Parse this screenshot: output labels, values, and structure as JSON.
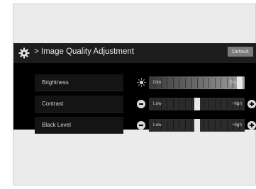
{
  "header": {
    "title": "> Image Quality Adjustment",
    "icon": "gear-icon",
    "default_label": "Default"
  },
  "rows": [
    {
      "label": "Brightness",
      "left_label": "Dim",
      "right_label": "Bright",
      "level": 0.98,
      "left_icon": "sun-icon"
    },
    {
      "label": "Contrast",
      "left_label": "Low",
      "right_label": "High",
      "level": 0.5,
      "left_icon": "minus-icon",
      "right_icon": "plus-icon"
    },
    {
      "label": "Black Level",
      "left_label": "Low",
      "right_label": "High",
      "level": 0.5,
      "left_icon": "minus-icon",
      "right_icon": "plus-icon"
    }
  ],
  "colors": {
    "screen_bg": "#000000",
    "header_bg": "#1d1d1d",
    "text": "#e6e6e6"
  }
}
